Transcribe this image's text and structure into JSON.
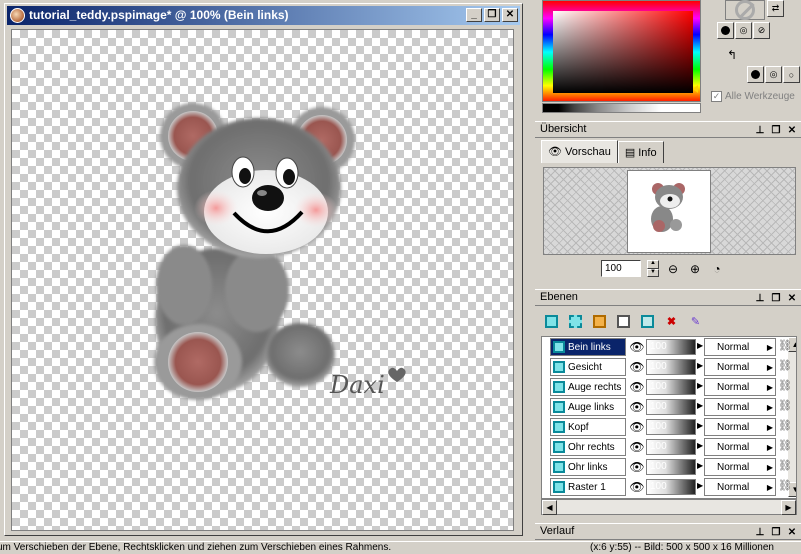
{
  "window": {
    "title": "tutorial_teddy.pspimage* @ 100% (Bein links)",
    "buttons": {
      "minimize": "_",
      "restore": "❐",
      "close": "✕"
    }
  },
  "canvas": {
    "watermark": "Daxi"
  },
  "materials": {
    "all_tools_label": "Alle Werkzeuge"
  },
  "overview": {
    "title": "Übersicht",
    "tabs": [
      {
        "label": "Vorschau"
      },
      {
        "label": "Info"
      }
    ],
    "zoom_value": "100"
  },
  "layers": {
    "title": "Ebenen",
    "items": [
      {
        "name": "Bein links",
        "opacity": "100",
        "blend": "Normal",
        "selected": true
      },
      {
        "name": "Gesicht",
        "opacity": "100",
        "blend": "Normal"
      },
      {
        "name": "Auge rechts",
        "opacity": "100",
        "blend": "Normal"
      },
      {
        "name": "Auge links",
        "opacity": "100",
        "blend": "Normal"
      },
      {
        "name": "Kopf",
        "opacity": "100",
        "blend": "Normal"
      },
      {
        "name": "Ohr rechts",
        "opacity": "100",
        "blend": "Normal"
      },
      {
        "name": "Ohr links",
        "opacity": "100",
        "blend": "Normal"
      },
      {
        "name": "Raster 1",
        "opacity": "100",
        "blend": "Normal"
      }
    ]
  },
  "history": {
    "title": "Verlauf"
  },
  "statusbar": {
    "left": "um Verschieben der Ebene, Rechtsklicken und ziehen zum Verschieben eines Rahmens.",
    "right": "(x:6 y:55) -- Bild:  500 x 500 x 16 Millionen"
  },
  "colors": {
    "title_start": "#0a246a",
    "title_end": "#a6caf0",
    "selection": "#0a246a",
    "face": "#d4d0c8",
    "layer_icon": "#7fe3e8"
  }
}
